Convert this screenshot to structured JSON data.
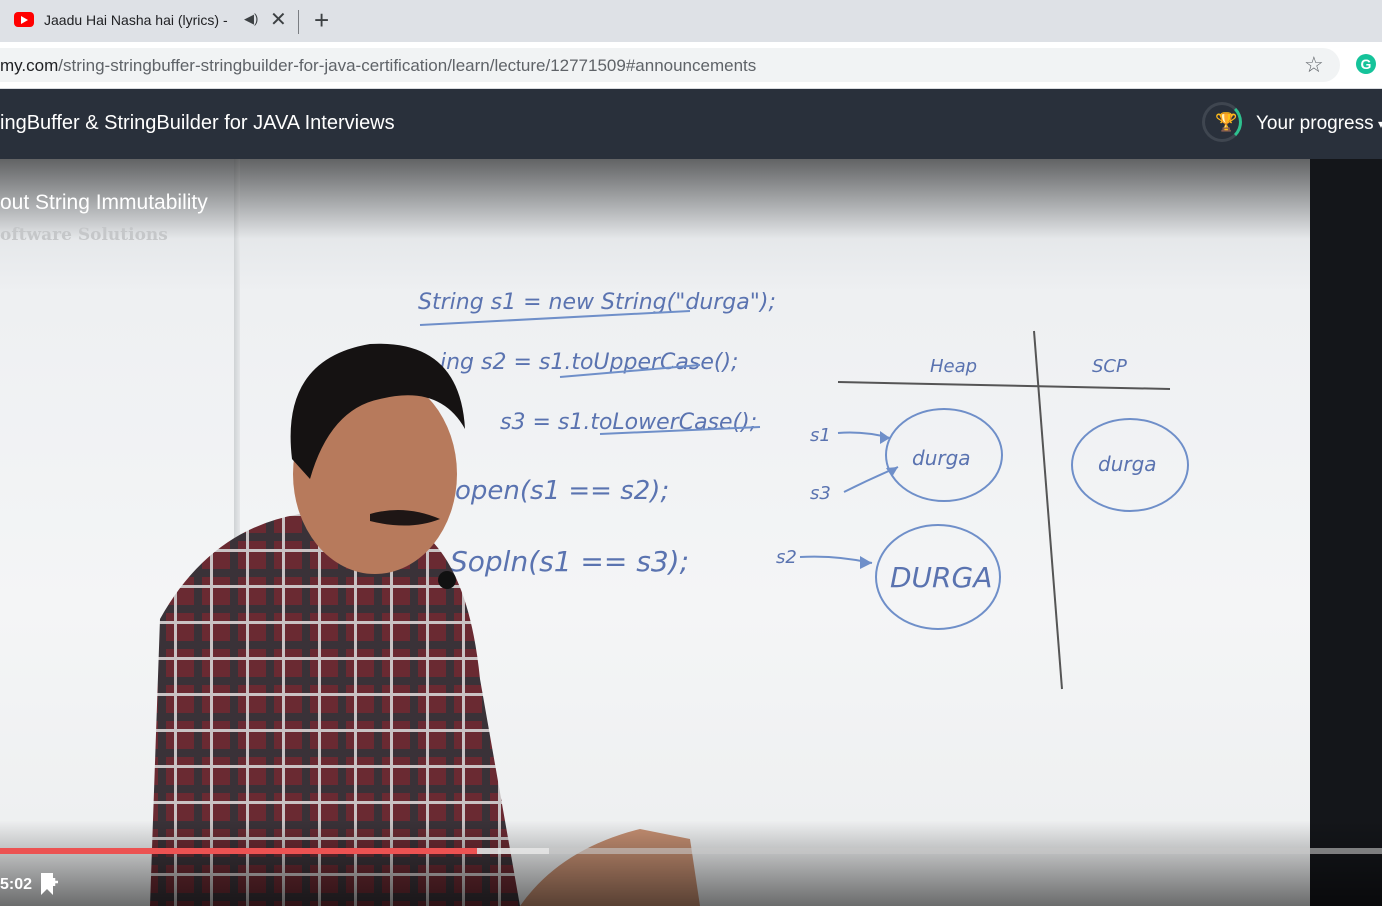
{
  "browser": {
    "tab": {
      "title": "Jaadu Hai Nasha hai (lyrics) -",
      "audio_icon": "speaker-icon",
      "close_icon": "close-icon"
    },
    "new_tab_label": "+",
    "address": {
      "host": "my.com",
      "path": "/string-stringbuffer-stringbuilder-for-java-certification/learn/lecture/12771509#announcements"
    },
    "extension_label": "G"
  },
  "course": {
    "title": "ingBuffer & StringBuilder for JAVA Interviews",
    "progress_label": "Your progress",
    "progress_caret": "▾"
  },
  "video": {
    "lecture_title": "out String Immutability",
    "watermark": "oftware Solutions",
    "current_time": "5:02",
    "played_fraction": 0.345,
    "buffered_fraction": 0.397,
    "board": {
      "line1": "String s1 = new String(\"durga\");",
      "line2": "ing s2 = s1.toUpperCase();",
      "line3": "s3 = s1.toLowerCase();",
      "line4": "open(s1 == s2);",
      "line5": "Sopln(s1 == s3);",
      "heap_label": "Heap",
      "scp_label": "SCP",
      "obj1": "durga",
      "obj2": "DURGA",
      "obj3": "durga",
      "ref1": "s1",
      "ref2": "s3",
      "ref3": "s2"
    }
  },
  "colors": {
    "progress_red": "#ec5252",
    "header_bg": "#29303b",
    "ink_blue": "#5a73b0"
  }
}
